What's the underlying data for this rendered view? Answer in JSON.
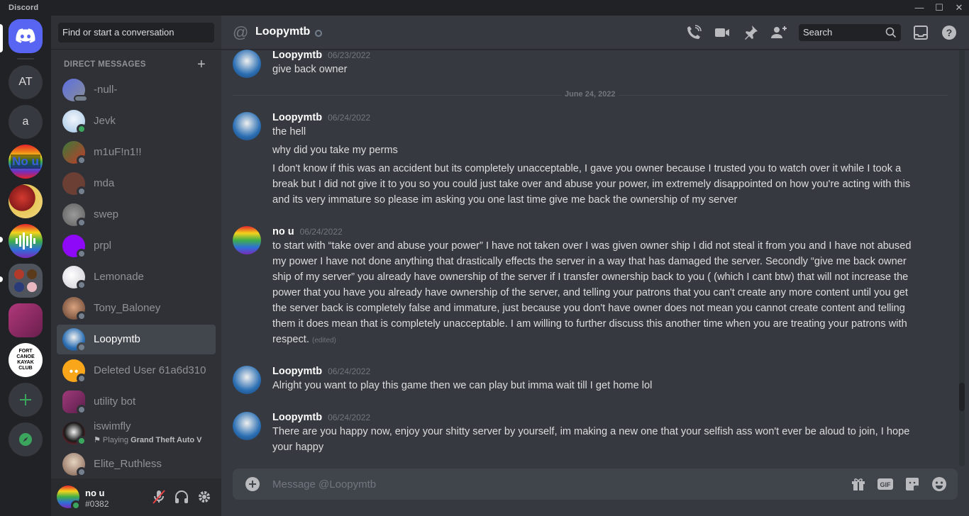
{
  "window": {
    "title": "Discord",
    "minimize": "—",
    "maximize": "☐",
    "close": "✕"
  },
  "servers": [
    {
      "id": "home",
      "kind": "home"
    },
    {
      "id": "AT",
      "label": "AT"
    },
    {
      "id": "a",
      "label": "a"
    },
    {
      "id": "no-u",
      "label": "No u"
    },
    {
      "id": "red-character"
    },
    {
      "id": "audio"
    },
    {
      "id": "folder"
    },
    {
      "id": "pink-chat"
    },
    {
      "id": "fort-canoe",
      "label": "FORT CANOE KAYAK CLUB"
    }
  ],
  "sidebar": {
    "search_label": "Find or start a conversation",
    "dm_header": "DIRECT MESSAGES",
    "dms": [
      {
        "name": "-null-",
        "status": "group"
      },
      {
        "name": "Jevk",
        "status": "online"
      },
      {
        "name": "m1uF!n1!!",
        "status": "offline"
      },
      {
        "name": "mda",
        "status": "offline"
      },
      {
        "name": "swep",
        "status": "offline"
      },
      {
        "name": "prpl",
        "status": "offline"
      },
      {
        "name": "Lemonade",
        "status": "offline"
      },
      {
        "name": "Tony_Baloney",
        "status": "offline"
      },
      {
        "name": "Loopymtb",
        "status": "offline",
        "active": true
      },
      {
        "name": "Deleted User 61a6d310",
        "status": "offline"
      },
      {
        "name": "utility bot",
        "status": "offline"
      },
      {
        "name": "iswimfly",
        "status": "online",
        "activity_prefix": "Playing ",
        "activity": "Grand Theft Auto V"
      },
      {
        "name": "Elite_Ruthless",
        "status": "offline"
      }
    ]
  },
  "user_panel": {
    "name": "no u",
    "tag": "#0382"
  },
  "chat": {
    "title": "Loopymtb",
    "search_placeholder": "Search",
    "date_divider": "June 24, 2022",
    "messages": [
      {
        "author": "Loopymtb",
        "time": "06/23/2022",
        "lines": [
          "give back owner"
        ]
      },
      {
        "author": "Loopymtb",
        "time": "06/24/2022",
        "lines": [
          "the hell",
          "why did you take my perms",
          "I don't know if this was an accident but its completely unacceptable, I gave you owner because I trusted you to watch over it while I took a break but I did not give it to you so you could just take over and abuse your power, im extremely disappointed on how you're acting with this and its very immature so please im asking you one last time give me back the ownership of my server"
        ]
      },
      {
        "author": "no u",
        "time": "06/24/2022",
        "lines": [
          "to start with “take over and abuse your power” I have not taken over I was given owner ship I did not steal it from you and I have not abused my power I have not done anything that drastically effects the server in a way that has damaged the server. Secondly “give me back owner ship of my server” you already have ownership of the server if I transfer ownership back to you ( (which I cant btw) that will not increase the power that you have you already have ownership of the server, and telling your patrons that you can't create any more content until you get the server back is completely false and immature, just because you don't have owner does not mean you cannot create content and telling them it does mean that is completely unacceptable. I am willing to further discuss this another time when you are treating your patrons with respect."
        ],
        "edited": "(edited)"
      },
      {
        "author": "Loopymtb",
        "time": "06/24/2022",
        "lines": [
          "Alright you want to play this game then we can play but imma wait till I get home lol"
        ]
      },
      {
        "author": "Loopymtb",
        "time": "06/24/2022",
        "lines": [
          "There are you happy now, enjoy your shitty server by yourself, im making a new one that your selfish ass won't ever be aloud to join, I hope your happy"
        ]
      }
    ],
    "composer_placeholder": "Message @Loopymtb"
  },
  "colors": {
    "accent": "#5865f2",
    "online": "#3ba55d",
    "offline": "#747f8d",
    "add_server": "#3ba55d"
  }
}
